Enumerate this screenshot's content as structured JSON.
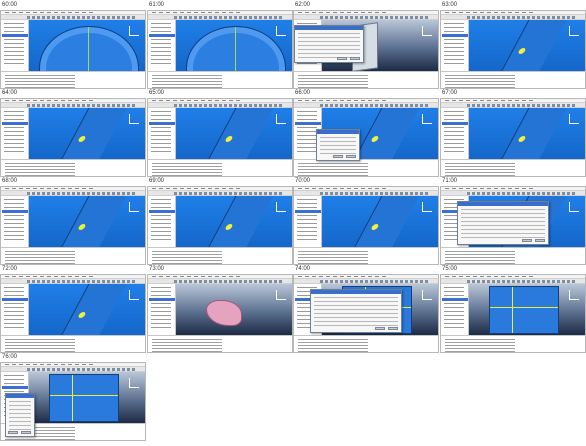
{
  "frames": [
    {
      "time": "60:00",
      "view": "blue",
      "shape": "shell",
      "tree": true,
      "dialog": false
    },
    {
      "time": "61:00",
      "view": "blue",
      "shape": "shell",
      "tree": true,
      "dialog": false
    },
    {
      "time": "62:00",
      "view": "dark",
      "shape": "panel",
      "tree": true,
      "dialog": true
    },
    {
      "time": "63:00",
      "view": "blue",
      "shape": "fin",
      "tree": true,
      "dialog": false
    },
    {
      "time": "64:00",
      "view": "blue",
      "shape": "fin",
      "tree": true,
      "dialog": false
    },
    {
      "time": "65:00",
      "view": "blue",
      "shape": "fin",
      "tree": true,
      "dialog": false
    },
    {
      "time": "66:00",
      "view": "blue",
      "shape": "fin",
      "tree": true,
      "dialog": true
    },
    {
      "time": "67:00",
      "view": "blue",
      "shape": "fin",
      "tree": true,
      "dialog": false
    },
    {
      "time": "68:00",
      "view": "blue",
      "shape": "fin",
      "tree": true,
      "dialog": false
    },
    {
      "time": "69:00",
      "view": "blue",
      "shape": "fin",
      "tree": true,
      "dialog": false
    },
    {
      "time": "70:00",
      "view": "blue",
      "shape": "fin",
      "tree": true,
      "dialog": false
    },
    {
      "time": "71:00",
      "view": "blue",
      "shape": "fin",
      "tree": true,
      "dialog": true
    },
    {
      "time": "72:00",
      "view": "blue",
      "shape": "fin",
      "tree": true,
      "dialog": false
    },
    {
      "time": "73:00",
      "view": "dark",
      "shape": "pink",
      "tree": true,
      "dialog": false
    },
    {
      "time": "74:00",
      "view": "dark",
      "shape": "plate",
      "tree": true,
      "dialog": true
    },
    {
      "time": "75:00",
      "view": "dark",
      "shape": "plate",
      "tree": true,
      "dialog": false
    },
    {
      "time": "76:00",
      "view": "dark",
      "shape": "plate",
      "tree": true,
      "dialog": true
    }
  ],
  "colors": {
    "model_blue": "#2a79dc",
    "viewport_blue": "#1f7fe8",
    "highlight_yellow": "#e8ef3a",
    "selection_blue": "#3a6fd1"
  }
}
